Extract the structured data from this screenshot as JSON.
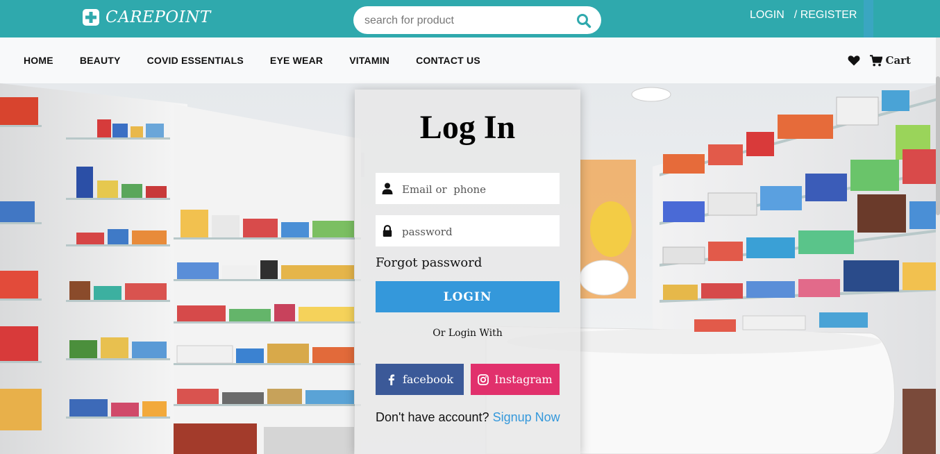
{
  "brand": {
    "name": "CAREPOINT",
    "color": "#2fa9ad"
  },
  "header": {
    "search_placeholder": "search for product",
    "login_label": "LOGIN",
    "register_label": "/ REGISTER"
  },
  "nav": {
    "items": [
      {
        "label": "HOME"
      },
      {
        "label": "BEAUTY"
      },
      {
        "label": "COVID ESSENTIALS"
      },
      {
        "label": "EYE WEAR"
      },
      {
        "label": "VITAMIN"
      },
      {
        "label": "CONTACT US"
      }
    ],
    "cart_label": "Cart"
  },
  "login_form": {
    "title": "Log In",
    "email_placeholder": "Email or  phone",
    "password_placeholder": "password",
    "forgot_label": "Forgot password",
    "login_button": "LOGIN",
    "or_login_with": "Or Login With",
    "facebook_label": "facebook",
    "instagram_label": "Instagram",
    "no_account_text": "Don't have account?",
    "signup_label": "Signup Now"
  },
  "colors": {
    "login_button": "#3498db",
    "facebook": "#3b5998",
    "instagram": "#e1306c"
  },
  "icons": [
    "plus-square-icon",
    "search-icon",
    "heart-icon",
    "cart-icon",
    "user-icon",
    "lock-icon",
    "facebook-icon",
    "instagram-icon"
  ]
}
